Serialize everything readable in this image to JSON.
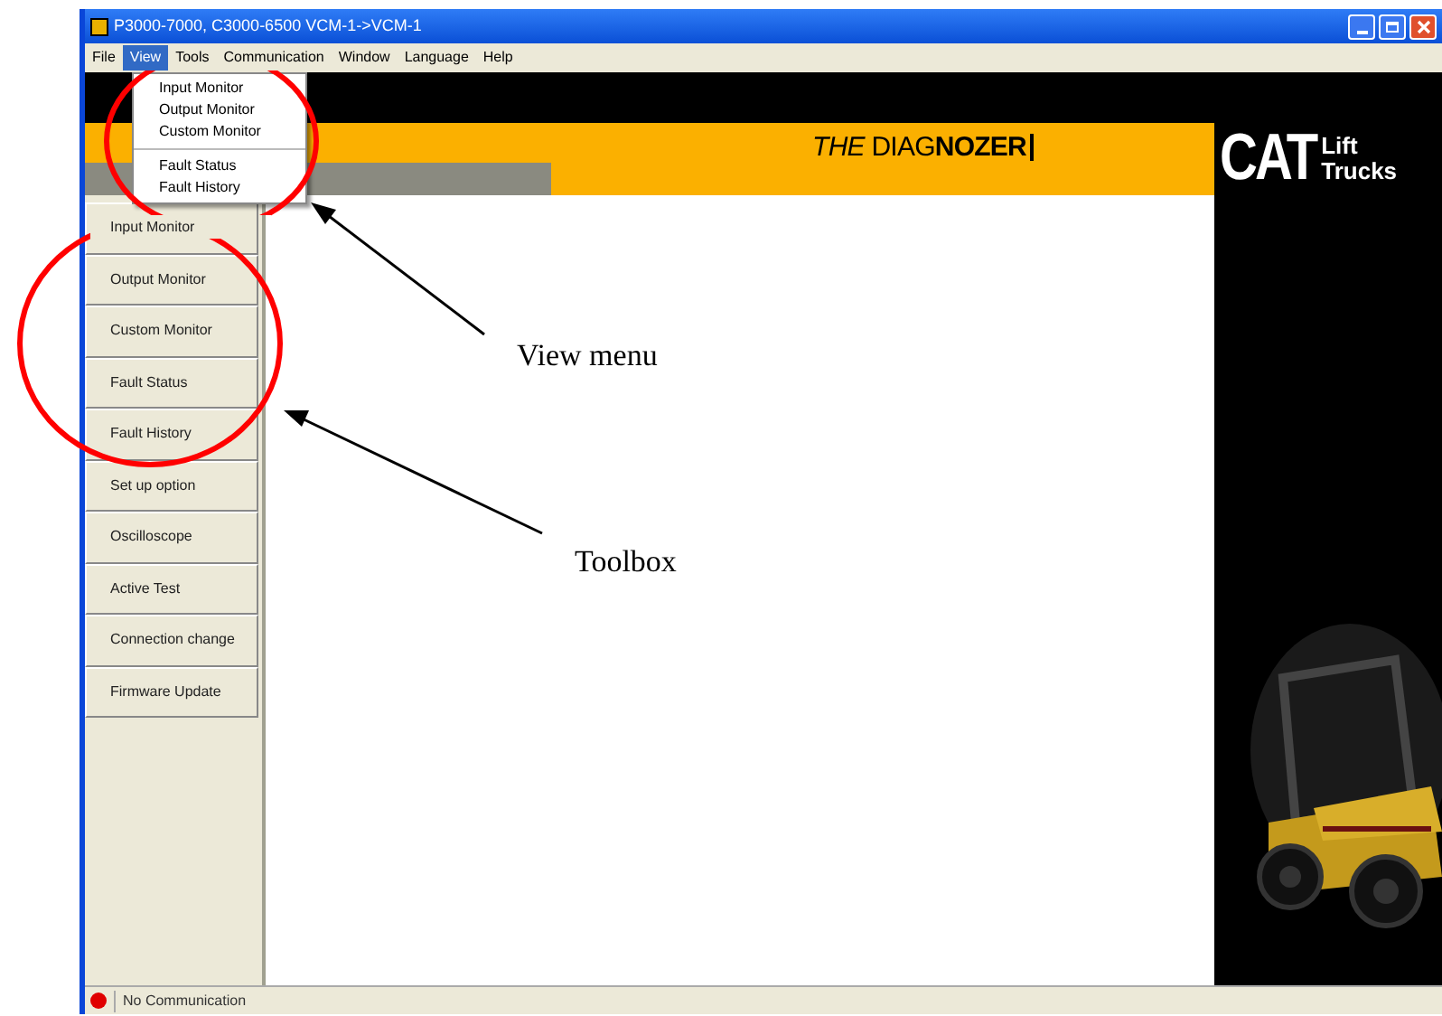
{
  "window": {
    "title": "P3000-7000, C3000-6500 VCM-1->VCM-1"
  },
  "menu_bar": [
    {
      "label": "File",
      "selected": false
    },
    {
      "label": "View",
      "selected": true
    },
    {
      "label": "Tools",
      "selected": false
    },
    {
      "label": "Communication",
      "selected": false
    },
    {
      "label": "Window",
      "selected": false
    },
    {
      "label": "Language",
      "selected": false
    },
    {
      "label": "Help",
      "selected": false
    }
  ],
  "view_menu": {
    "groups": [
      {
        "items": [
          "Input Monitor",
          "Output Monitor",
          "Custom Monitor"
        ]
      },
      {
        "items": [
          "Fault Status",
          "Fault History"
        ]
      }
    ]
  },
  "banner": {
    "title": "*THE* DIAG**NOZER**"
  },
  "logo": {
    "brand": "CAT",
    "subtitle": [
      "Lift",
      "Trucks"
    ]
  },
  "toolbox": [
    "Input Monitor",
    "Output Monitor",
    "Custom Monitor",
    "Fault Status",
    "Fault History",
    "Set up option",
    "Oscilloscope",
    "Active Test",
    "Connection change",
    "Firmware Update"
  ],
  "status_bar": {
    "connected": false,
    "text": "No Communication"
  },
  "annotations": [
    {
      "label": "View menu"
    },
    {
      "label": "Toolbox"
    }
  ]
}
